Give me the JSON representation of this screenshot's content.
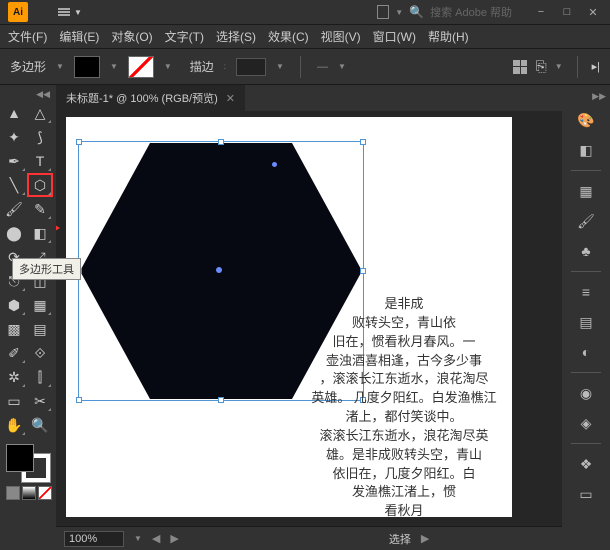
{
  "titlebar": {
    "logo": "Ai",
    "search_placeholder": "搜索 Adobe 帮助",
    "win_min": "−",
    "win_max": "□",
    "win_close": "✕"
  },
  "menu": {
    "file": "文件(F)",
    "edit": "编辑(E)",
    "object": "对象(O)",
    "type": "文字(T)",
    "select": "选择(S)",
    "effect": "效果(C)",
    "view": "视图(V)",
    "window": "窗口(W)",
    "help": "帮助(H)"
  },
  "options": {
    "shape_label": "多边形",
    "stroke_label": "描边",
    "stroke_value": "",
    "fill_color": "#000000",
    "stroke_none": true
  },
  "tab": {
    "title": "未标题-1* @ 100% (RGB/预览)",
    "close": "✕"
  },
  "tooltip": {
    "polygon": "多边形工具"
  },
  "body_text": "是非成\n败转头空，青山依\n旧在，惯看秋月春风。一\n壶浊酒喜相逢，古今多少事\n，滚滚长江东逝水，浪花淘尽\n英雄。 几度夕阳红。白发渔樵江\n渚上，都付笑谈中。\n滚滚长江东逝水，浪花淘尽英\n雄。是非成败转头空，青山\n依旧在，几度夕阳红。白\n发渔樵江渚上，惯\n看秋月",
  "status": {
    "zoom": "100%",
    "selection": "选择"
  },
  "chart_data": {
    "type": "shape",
    "shape": "hexagon",
    "fill": "#060812",
    "sides": 6,
    "selected": true
  }
}
